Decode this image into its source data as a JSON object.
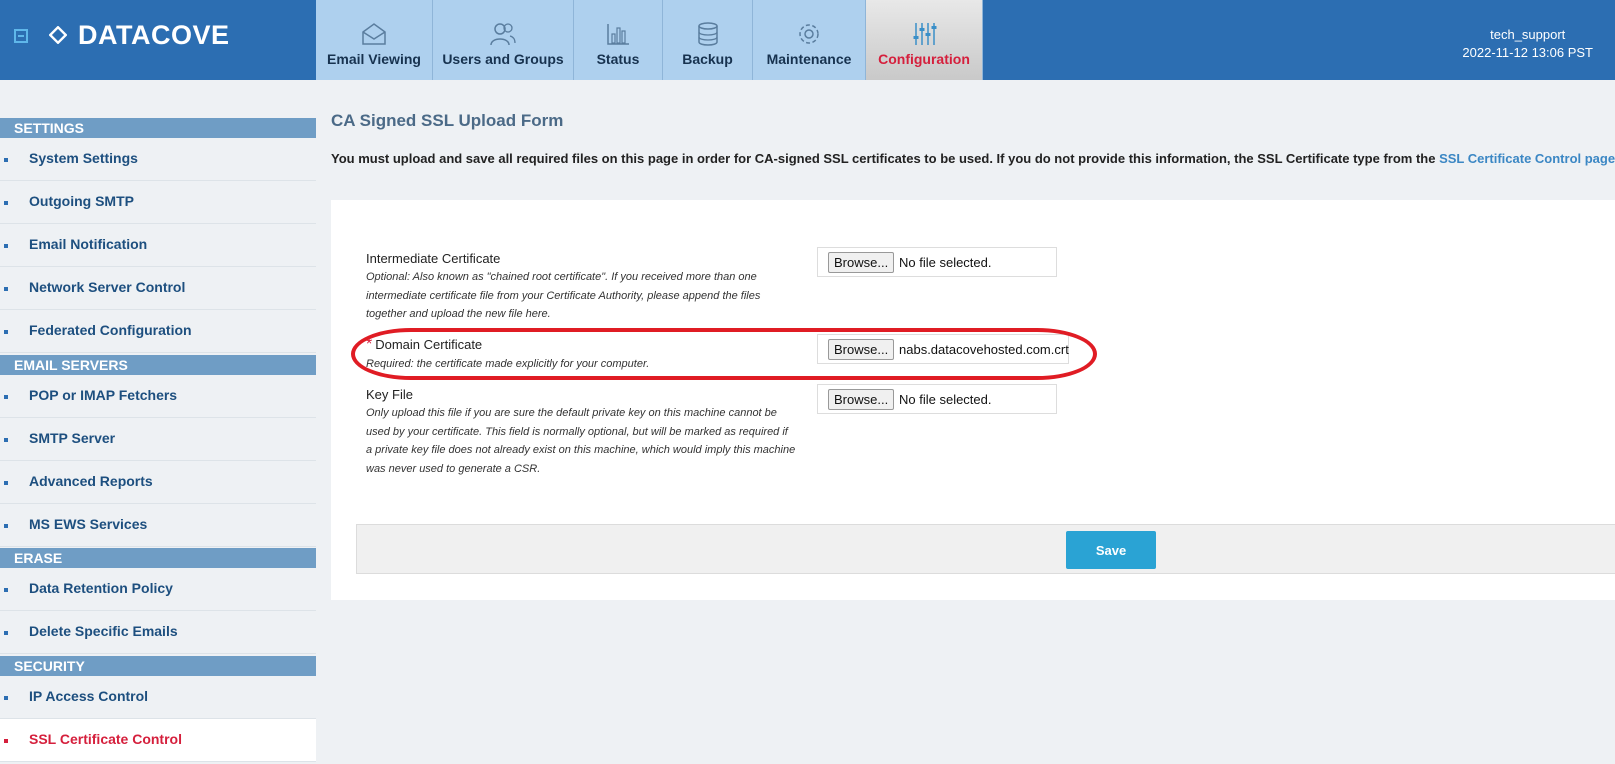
{
  "brand": {
    "name": "DATACOVE"
  },
  "nav": {
    "tabs": [
      {
        "label": "Email Viewing",
        "icon": "envelope-icon"
      },
      {
        "label": "Users and Groups",
        "icon": "users-icon"
      },
      {
        "label": "Status",
        "icon": "bar-chart-icon"
      },
      {
        "label": "Backup",
        "icon": "database-icon"
      },
      {
        "label": "Maintenance",
        "icon": "gear-icon"
      },
      {
        "label": "Configuration",
        "icon": "sliders-icon",
        "active": true
      }
    ]
  },
  "user": {
    "name": "tech_support",
    "datetime": "2022-11-12 13:06 PST"
  },
  "sidebar": {
    "sections": [
      {
        "title": "SETTINGS",
        "items": [
          "System Settings",
          "Outgoing SMTP",
          "Email Notification",
          "Network Server Control",
          "Federated Configuration"
        ]
      },
      {
        "title": "EMAIL SERVERS",
        "items": [
          "POP or IMAP Fetchers",
          "SMTP Server",
          "Advanced Reports",
          "MS EWS Services"
        ]
      },
      {
        "title": "ERASE",
        "items": [
          "Data Retention Policy",
          "Delete Specific Emails"
        ]
      },
      {
        "title": "SECURITY",
        "items": [
          "IP Access Control",
          "SSL Certificate Control"
        ]
      }
    ],
    "active_item": "SSL Certificate Control"
  },
  "page": {
    "title": "CA Signed SSL Upload Form",
    "description": "You must upload and save all required files on this page in order for CA-signed SSL certificates to be used. If you do not provide this information, the SSL Certificate type from the ",
    "description_link": "SSL Certificate Control page"
  },
  "form": {
    "fields": [
      {
        "label": "Intermediate Certificate",
        "help": "Optional: Also known as \"chained root certificate\". If you received more than one intermediate certificate file from your Certificate Authority, please append the files together and upload the new file here.",
        "file": "No file selected.",
        "required": false
      },
      {
        "label": "Domain Certificate",
        "help": "Required: the certificate made explicitly for your computer.",
        "file": "nabs.datacovehosted.com.crt",
        "required": true
      },
      {
        "label": "Key File",
        "help": "Only upload this file if you are sure the default private key on this machine cannot be used by your certificate. This field is normally optional, but will be marked as required if a private key file does not already exist on this machine, which would imply this machine was never used to generate a CSR.",
        "file": "No file selected.",
        "required": false
      }
    ],
    "browse_label": "Browse...",
    "required_mark": "*",
    "save_label": "Save"
  },
  "colors": {
    "header": "#2c6eb2",
    "tab": "#aed0ee",
    "accent": "#d51f3c",
    "save": "#2aa3d4",
    "highlight": "#e01c24"
  }
}
